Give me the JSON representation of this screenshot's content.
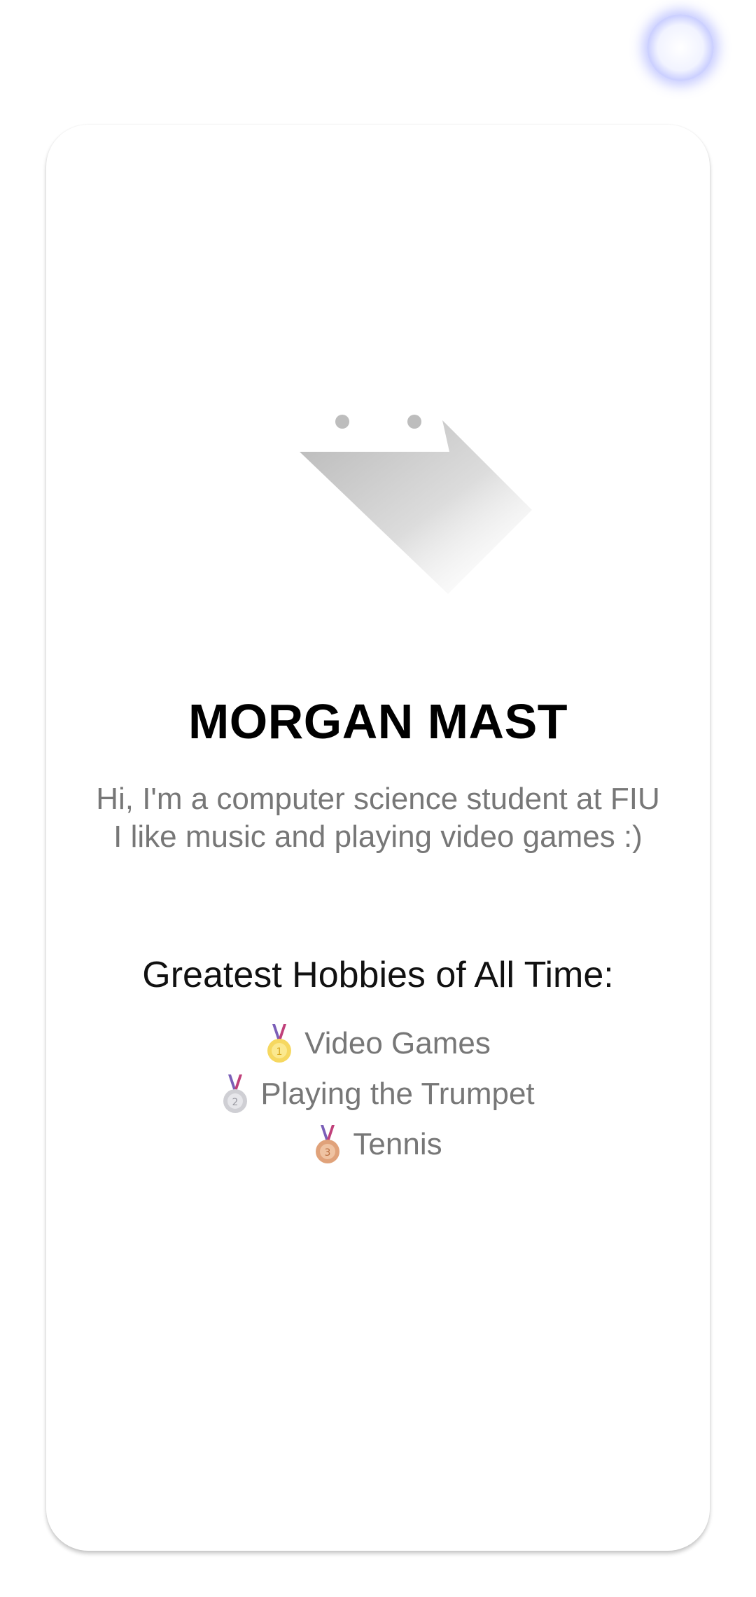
{
  "profile": {
    "name": "MORGAN MAST",
    "bio_line1": "Hi, I'm a computer science student at FIU",
    "bio_line2": "I like music and playing video games :)"
  },
  "hobbies": {
    "title": "Greatest Hobbies of All Time:",
    "items": [
      {
        "icon": "gold-medal-icon",
        "label": "Video Games"
      },
      {
        "icon": "silver-medal-icon",
        "label": "Playing the Trumpet"
      },
      {
        "icon": "bronze-medal-icon",
        "label": "Tennis"
      }
    ]
  },
  "colors": {
    "background": "#ffffff",
    "name_text": "#000000",
    "body_text": "#777777",
    "touch_indicator": "#8a93ff"
  }
}
